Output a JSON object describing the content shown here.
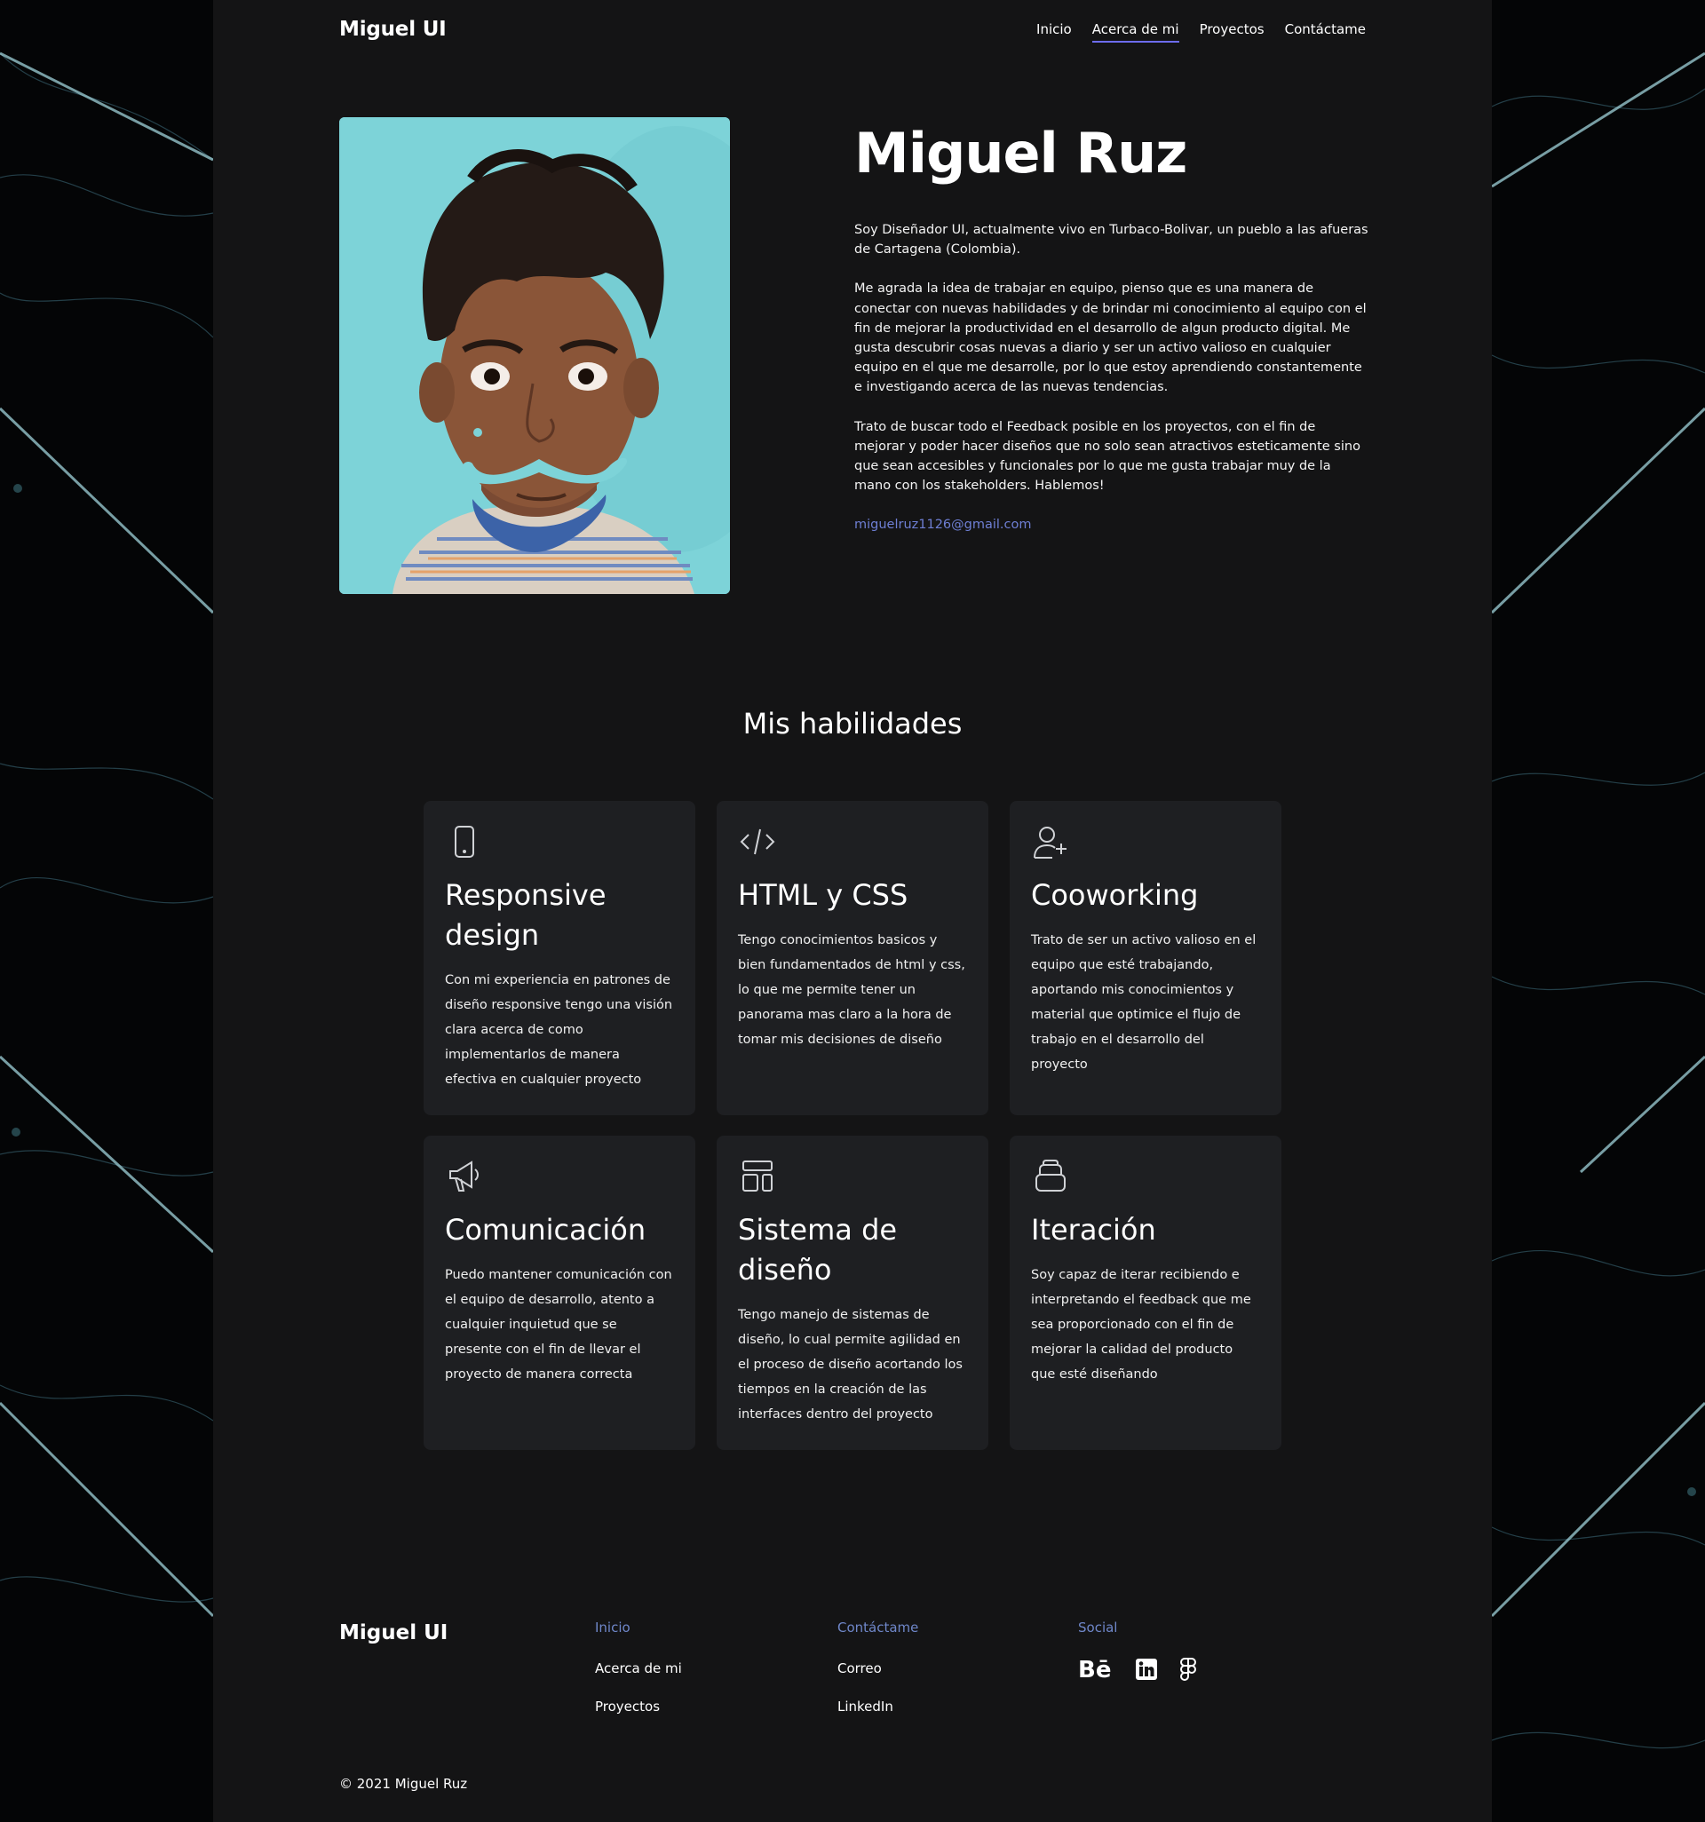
{
  "brand": "Miguel UI",
  "nav": {
    "items": [
      "Inicio",
      "Acerca de mi",
      "Proyectos",
      "Contáctame"
    ],
    "active": "Acerca de mi"
  },
  "hero": {
    "name": "Miguel Ruz",
    "paragraphs": [
      "Soy Diseñador UI, actualmente vivo en Turbaco-Bolivar, un pueblo a las afueras de Cartagena (Colombia).",
      "Me agrada la idea de trabajar en equipo, pienso que es una manera de conectar con nuevas habilidades y de brindar mi conocimiento al equipo con el fin de mejorar la productividad en el desarrollo de algun producto digital. Me gusta descubrir cosas nuevas a diario y ser un activo valioso en cualquier equipo en el que me desarrolle, por lo que estoy aprendiendo constantemente e investigando acerca de las nuevas tendencias.",
      "Trato de buscar todo el Feedback posible en los proyectos, con el fin de mejorar y poder hacer diseños que no solo sean atractivos esteticamente sino que sean accesibles y funcionales por lo que me gusta trabajar muy de la mano con los stakeholders. Hablemos!"
    ],
    "email": "miguelruz1126@gmail.com"
  },
  "skills": {
    "title": "Mis habilidades",
    "cards": [
      {
        "icon": "smartphone-icon",
        "title": "Responsive design",
        "text": "Con mi experiencia en patrones de diseño responsive tengo una visión clara acerca de como implementarlos de manera efectiva en cualquier proyecto"
      },
      {
        "icon": "code-icon",
        "title": "HTML y CSS",
        "text": "Tengo conocimientos basicos y bien fundamentados de html y css, lo que me permite tener un panorama mas claro a la hora de tomar mis decisiones de diseño"
      },
      {
        "icon": "user-plus-icon",
        "title": "Cooworking",
        "text": "Trato de ser un activo valioso en el equipo que esté trabajando, aportando mis conocimientos y material que optimice el flujo de trabajo en el desarrollo del proyecto"
      },
      {
        "icon": "megaphone-icon",
        "title": "Comunicación",
        "text": "Puedo mantener comunicación con el equipo de desarrollo, atento a cualquier inquietud que se presente con el fin de llevar el proyecto de manera correcta"
      },
      {
        "icon": "layout-icon",
        "title": "Sistema de diseño",
        "text": "Tengo manejo de sistemas de diseño, lo cual permite agilidad en el proceso de diseño acortando los tiempos en la creación de las interfaces dentro del proyecto"
      },
      {
        "icon": "stack-icon",
        "title": "Iteración",
        "text": "Soy capaz de iterar recibiendo e interpretando el feedback que me sea proporcionado con el fin de mejorar la calidad del producto que esté diseñando"
      }
    ]
  },
  "footer": {
    "brand": "Miguel UI",
    "col1": {
      "heading": "Inicio",
      "links": [
        "Acerca de mi",
        "Proyectos"
      ]
    },
    "col2": {
      "heading": "Contáctame",
      "links": [
        "Correo",
        "LinkedIn"
      ]
    },
    "col3": {
      "heading": "Social",
      "icons": [
        "behance-icon",
        "linkedin-icon",
        "figma-icon"
      ]
    },
    "copyright": "© 2021 Miguel Ruz"
  },
  "colors": {
    "accent": "#6d6cf0",
    "link": "#6e7fd4",
    "footer_heading": "#6f87c9",
    "card_bg": "#1e1f22",
    "page_bg": "#141415",
    "photo_bg": "#7dd3d8"
  }
}
